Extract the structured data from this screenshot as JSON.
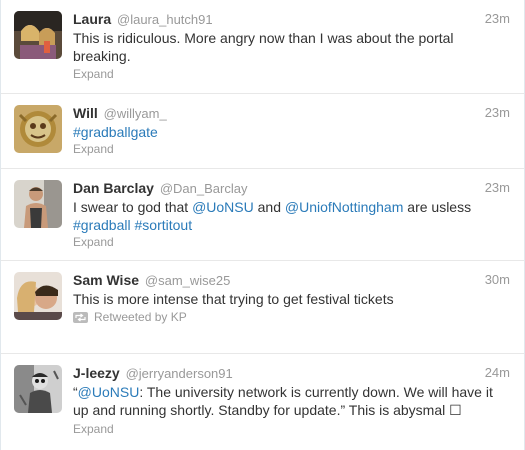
{
  "tweets": [
    {
      "fullname": "Laura",
      "username": "@laura_hutch91",
      "time": "23m",
      "text_line1": "This is ridiculous. More angry now than I was about the portal",
      "text_line2": "breaking.",
      "expand": "Expand"
    },
    {
      "fullname": "Will",
      "username": "@willyam_",
      "time": "23m",
      "hashtag": "#gradballgate",
      "expand": "Expand"
    },
    {
      "fullname": "Dan Barclay",
      "username": "@Dan_Barclay",
      "time": "23m",
      "prefix": "I swear to god that ",
      "mention1": "@UoNSU",
      "middle": " and ",
      "mention2": "@UniofNottingham",
      "suffix": " are usless",
      "hashtag1": "#gradball",
      "hashtag2": "#sortitout",
      "expand": "Expand"
    },
    {
      "fullname": "Sam Wise",
      "username": "@sam_wise25",
      "time": "30m",
      "text": "This is more intense that trying to get festival tickets",
      "retweeted_by": "Retweeted by KP",
      "retweet_icon": "retweet-icon"
    },
    {
      "fullname": "J-leezy",
      "username": "@jerryanderson91",
      "time": "24m",
      "open_quote": "“",
      "mention": "@UoNSU",
      "line1_rest": ": The university network is currently down. We will have it",
      "line2": "up and running shortly. Standby for update.” This is abysmal ☐",
      "expand": "Expand"
    }
  ]
}
